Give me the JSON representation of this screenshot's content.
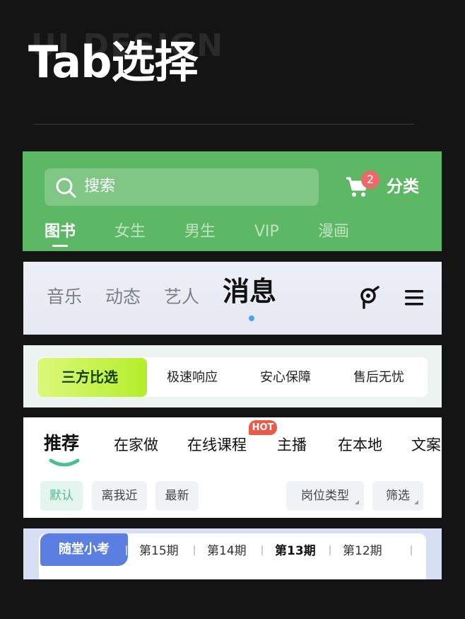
{
  "header": {
    "title": "Tab选择",
    "bg_word": "UI DESIGN"
  },
  "panel1": {
    "search_placeholder": "搜索",
    "cart_badge": "2",
    "category_label": "分类",
    "tabs": [
      "图书",
      "女生",
      "男生",
      "VIP",
      "漫画"
    ],
    "active_tab": "图书",
    "bg_color": "#5db865"
  },
  "panel2": {
    "tabs": [
      "音乐",
      "动态",
      "艺人",
      "消息"
    ],
    "active_tab": "消息",
    "accent": "#4aa3e8"
  },
  "panel3": {
    "tabs": [
      "三方比选",
      "极速响应",
      "安心保障",
      "售后无忧"
    ],
    "active_tab": "三方比选"
  },
  "panel4": {
    "tabs": [
      "推荐",
      "在家做",
      "在线课程",
      "主播",
      "在本地",
      "文案"
    ],
    "active_tab": "推荐",
    "hot_badge": "HOT",
    "filters": [
      "默认",
      "离我近",
      "最新",
      "岗位类型",
      "筛选"
    ],
    "active_filter": "默认",
    "accent": "#4bbf8f"
  },
  "panel5": {
    "pill_label": "随堂小考",
    "episodes": [
      "第15期",
      "第14期",
      "第13期",
      "第12期"
    ],
    "active_episode": "第13期"
  }
}
